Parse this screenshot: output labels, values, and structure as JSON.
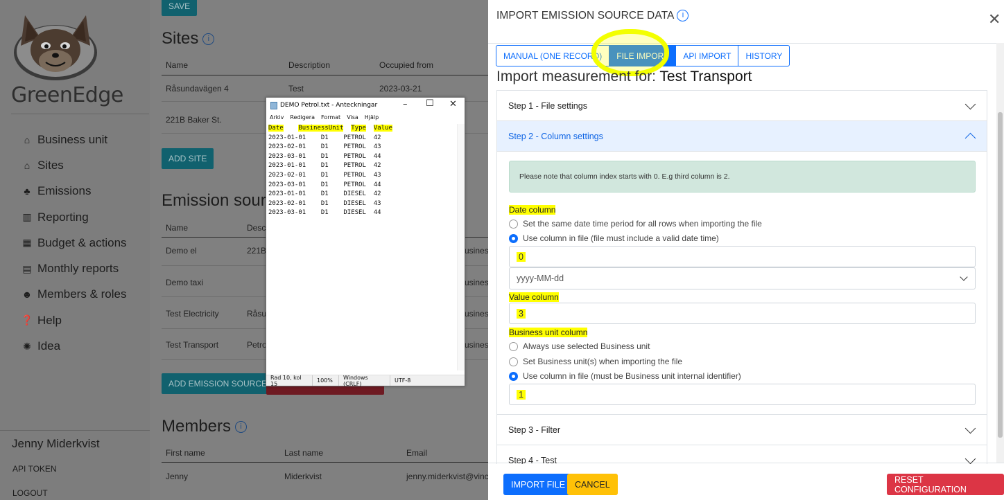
{
  "sidebar": {
    "brand": "GreenEdge",
    "items": [
      {
        "label": "Business unit",
        "icon": "home-icon"
      },
      {
        "label": "Sites",
        "icon": "house-icon"
      },
      {
        "label": "Emissions",
        "icon": "plant-icon"
      },
      {
        "label": "Reporting",
        "icon": "chart-icon"
      },
      {
        "label": "Budget & actions",
        "icon": "calculator-icon"
      },
      {
        "label": "Monthly reports",
        "icon": "report-icon"
      },
      {
        "label": "Members & roles",
        "icon": "users-icon"
      },
      {
        "label": "Help",
        "icon": "help-icon"
      },
      {
        "label": "Idea",
        "icon": "lightbulb-icon"
      }
    ],
    "user": "Jenny Miderkvist",
    "api_token": "API TOKEN",
    "logout": "LOGOUT"
  },
  "main": {
    "save_label": "SAVE",
    "sites_title": "Sites",
    "sites_headers": [
      "Name",
      "Description",
      "Occupied from"
    ],
    "sites_rows": [
      [
        "Råsundavägen 4",
        "Test",
        "2023-03-21"
      ],
      [
        "221B Baker St.",
        "",
        ""
      ]
    ],
    "add_site_label": "ADD SITE",
    "emission_title": "Emission sourc",
    "emission_headers": [
      "Name",
      "Desc"
    ],
    "emission_rows": [
      [
        "Demo el",
        "221B",
        "usines"
      ],
      [
        "Demo taxi",
        "",
        "usines"
      ],
      [
        "Test Electricity",
        "Råsu",
        "usines"
      ],
      [
        "Test Transport",
        "Petro",
        "usines"
      ]
    ],
    "add_emission_label": "ADD EMISSION SOURCE",
    "members_title": "Members",
    "members_headers": [
      "First name",
      "Last name",
      "Email"
    ],
    "members_rows": [
      [
        "Jenny",
        "Miderkvist",
        "jenny.miderkvist@vinci"
      ]
    ]
  },
  "notepad": {
    "title": "DEMO Petrol.txt - Anteckningar",
    "menu": [
      "Arkiv",
      "Redigera",
      "Format",
      "Visa",
      "Hjälp"
    ],
    "header": [
      "Date",
      "BusinessUnit",
      "Type",
      "Value"
    ],
    "rows": [
      [
        "2023-01-01",
        "D1",
        "PETROL",
        "42"
      ],
      [
        "2023-02-01",
        "D1",
        "PETROL",
        "43"
      ],
      [
        "2023-03-01",
        "D1",
        "PETROL",
        "44"
      ],
      [
        "2023-01-01",
        "D1",
        "PETROL",
        "42"
      ],
      [
        "2023-02-01",
        "D1",
        "PETROL",
        "43"
      ],
      [
        "2023-03-01",
        "D1",
        "PETROL",
        "44"
      ],
      [
        "2023-01-01",
        "D1",
        "DIESEL",
        "42"
      ],
      [
        "2023-02-01",
        "D1",
        "DIESEL",
        "43"
      ],
      [
        "2023-03-01",
        "D1",
        "DIESEL",
        "44"
      ]
    ],
    "status": [
      "Rad 10, kol 15",
      "100%",
      "Windows (CRLF)",
      "UTF-8"
    ]
  },
  "panel": {
    "title": "IMPORT EMISSION SOURCE DATA",
    "tabs": [
      "MANUAL (ONE RECORD)",
      "FILE IMPORT",
      "API IMPORT",
      "HISTORY"
    ],
    "active_tab": "FILE IMPORT",
    "import_prefix": "Import measurement for:",
    "import_target": "Test Transport",
    "step1": "Step 1 - File settings",
    "step2": "Step 2 - Column settings",
    "step3": "Step 3 - Filter",
    "step4": "Step 4 - Test",
    "note": "Please note that column index starts with 0. E.g third column is 2.",
    "date_column_label": "Date column",
    "date_option_1": "Set the same date time period for all rows when importing the file",
    "date_option_2": "Use column in file (file must include a valid date time)",
    "date_column_value": "0",
    "date_format": "yyyy-MM-dd",
    "value_column_label": "Value column",
    "value_column_value": "3",
    "bu_column_label": "Business unit column",
    "bu_option_1": "Always use selected Business unit",
    "bu_option_2": "Set Business unit(s) when importing the file",
    "bu_option_3": "Use column in file (must be Business unit internal identifier)",
    "bu_column_value": "1",
    "import_button": "IMPORT FILE",
    "cancel_button": "CANCEL",
    "reset_button": "RESET CONFIGURATION"
  },
  "colors": {
    "primary": "#0d6efd",
    "warning": "#ffc107",
    "danger": "#dc3545",
    "highlight": "#ffff00"
  }
}
